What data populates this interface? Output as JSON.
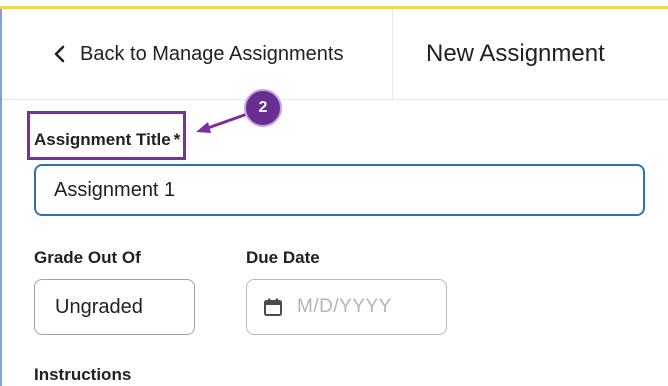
{
  "header": {
    "back_label": "Back to Manage Assignments",
    "page_title": "New Assignment"
  },
  "callout": {
    "number": "2",
    "color": "#6a2d91"
  },
  "form": {
    "title_label": "Assignment Title",
    "title_required_mark": "*",
    "title_value": "Assignment 1",
    "grade_label": "Grade Out Of",
    "grade_value": "Ungraded",
    "due_label": "Due Date",
    "due_placeholder": "M/D/YYYY",
    "instructions_label": "Instructions"
  },
  "icons": {
    "back": "chevron-left-icon",
    "due_date": "calendar-icon"
  },
  "colors": {
    "accent_line": "#f0d75a",
    "input_focus": "#2b73b6",
    "highlight": "#7b2f9e"
  }
}
